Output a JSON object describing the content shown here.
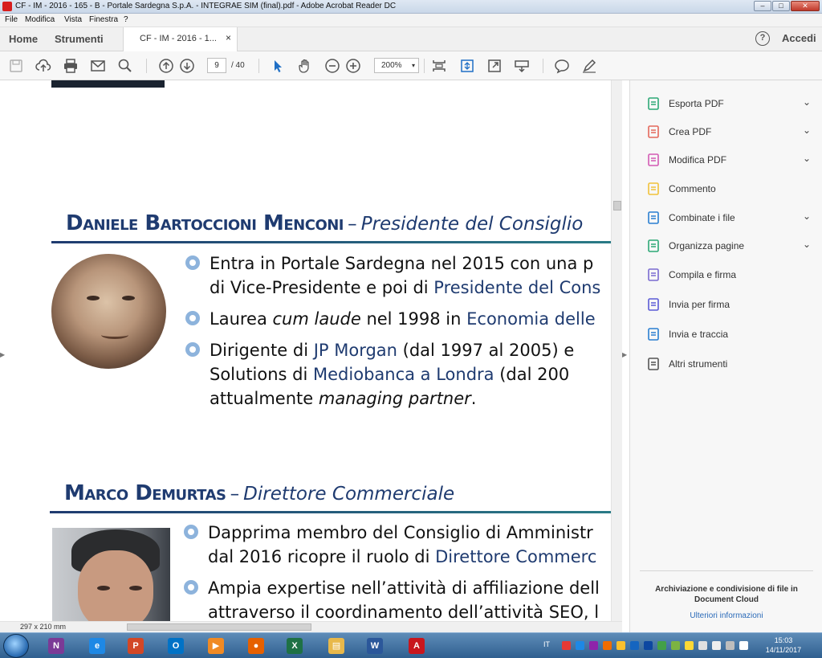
{
  "window": {
    "title": "CF - IM - 2016 - 165 - B - Portale Sardegna S.p.A. - INTEGRAE SIM (final).pdf - Adobe Acrobat Reader DC",
    "min": "–",
    "max": "□",
    "close": "✕"
  },
  "menu": [
    "File",
    "Modifica",
    "Vista",
    "Finestra",
    "?"
  ],
  "tabs": {
    "home": "Home",
    "tools": "Strumenti",
    "document": "CF - IM - 2016 - 1...",
    "close": "×",
    "help": "?",
    "signin": "Accedi"
  },
  "toolbar": {
    "page_current": "9",
    "page_total": "/ 40",
    "zoom": "200%",
    "zoom_caret": "▾"
  },
  "document": {
    "section1": {
      "name": "Daniele Bartoccioni Menconi",
      "dash": "–",
      "role": "Presidente del Consiglio",
      "bullets": [
        {
          "line1": [
            "Entra in Portale Sardegna nel 2015 con una p"
          ],
          "line2": [
            "di Vice-Presidente e poi di ",
            "Presidente del Cons"
          ]
        },
        {
          "line1": [
            "Laurea ",
            "cum laude",
            " nel 1998 in ",
            "Economia delle"
          ]
        },
        {
          "line1": [
            "Dirigente di ",
            "JP Morgan",
            " (dal 1997 al 2005) e"
          ],
          "line2": [
            "Solutions di ",
            "Mediobanca a Londra",
            " (dal 200"
          ],
          "line3": [
            "attualmente ",
            "managing partner",
            "."
          ]
        }
      ]
    },
    "section2": {
      "name": "Marco Demurtas",
      "dash": "–",
      "role": "Direttore Commerciale",
      "bullets": [
        {
          "line1": [
            "Dapprima membro del Consiglio di Amministr"
          ],
          "line2": [
            "dal 2016 ricopre il ruolo di ",
            "Direttore Commerc"
          ]
        },
        {
          "line1": [
            "Ampia expertise nell’attività di affiliazione dell"
          ],
          "line2": [
            "attraverso il coordinamento dell’attività SEO, l"
          ]
        }
      ]
    },
    "page_size": "297 x 210 mm"
  },
  "right_panel": {
    "tools": [
      {
        "label": "Esporta PDF",
        "icon": "export-pdf-icon",
        "color": "#2da876",
        "chevron": true
      },
      {
        "label": "Crea PDF",
        "icon": "create-pdf-icon",
        "color": "#e4685b",
        "chevron": true
      },
      {
        "label": "Modifica PDF",
        "icon": "edit-pdf-icon",
        "color": "#d35ab4",
        "chevron": true
      },
      {
        "label": "Commento",
        "icon": "comment-icon",
        "color": "#f0c23a",
        "chevron": false
      },
      {
        "label": "Combinate i file",
        "icon": "combine-files-icon",
        "color": "#2a7fd1",
        "chevron": true
      },
      {
        "label": "Organizza pagine",
        "icon": "organize-pages-icon",
        "color": "#2da876",
        "chevron": true
      },
      {
        "label": "Compila e firma",
        "icon": "fill-sign-icon",
        "color": "#7a6bd1",
        "chevron": false
      },
      {
        "label": "Invia per firma",
        "icon": "send-for-signature-icon",
        "color": "#5a5ad6",
        "chevron": false
      },
      {
        "label": "Invia e traccia",
        "icon": "send-track-icon",
        "color": "#2a7fd1",
        "chevron": false
      },
      {
        "label": "Altri strumenti",
        "icon": "more-tools-icon",
        "color": "#555555",
        "chevron": false
      }
    ],
    "chevron": "⌄",
    "footer_title": "Archiviazione e condivisione di file in Document Cloud",
    "footer_link": "Ulteriori informazioni"
  },
  "taskbar": {
    "apps": [
      {
        "name": "OneNote",
        "glyph": "N",
        "color": "#7b3a96"
      },
      {
        "name": "Internet Explorer",
        "glyph": "e",
        "color": "#1e88e5"
      },
      {
        "name": "PowerPoint",
        "glyph": "P",
        "color": "#d24726"
      },
      {
        "name": "Outlook",
        "glyph": "O",
        "color": "#0072c6"
      },
      {
        "name": "Media Player",
        "glyph": "▶",
        "color": "#f08a24"
      },
      {
        "name": "Firefox",
        "glyph": "●",
        "color": "#e66000"
      },
      {
        "name": "Excel",
        "glyph": "X",
        "color": "#1e7145"
      },
      {
        "name": "Explorer",
        "glyph": "▤",
        "color": "#e8b84a"
      },
      {
        "name": "Word",
        "glyph": "W",
        "color": "#2b579a"
      },
      {
        "name": "Acrobat",
        "glyph": "A",
        "color": "#c8161d"
      }
    ],
    "language": "IT",
    "time": "15:03",
    "date": "14/11/2017"
  }
}
